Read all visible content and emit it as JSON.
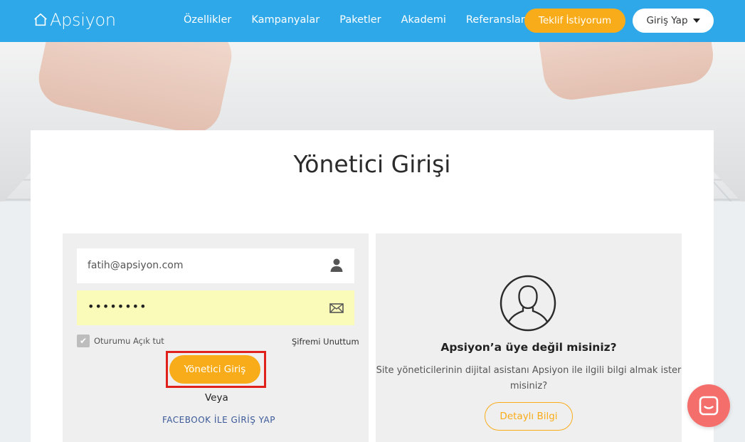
{
  "brand": {
    "name": "Apsiyon"
  },
  "nav": {
    "items": [
      "Özellikler",
      "Kampanyalar",
      "Paketler",
      "Akademi",
      "Referanslar"
    ],
    "offer_button": "Teklif İstiyorum",
    "login_button": "Giriş Yap"
  },
  "page": {
    "title": "Yönetici Girişi"
  },
  "login_form": {
    "email_value": "fatih@apsiyon.com",
    "password_value": "••••••••",
    "remember_label": "Oturumu Açık tut",
    "forgot_link": "Şifremi Unuttum",
    "submit_label": "Yönetici Giriş",
    "or_label": "Veya",
    "facebook_label": "FACEBOOK İLE GİRİŞ YAP"
  },
  "signup_panel": {
    "heading": "Apsiyon’a üye değil misiniz?",
    "description": "Site yöneticilerinin dijital asistanı Apsiyon ile ilgili bilgi almak ister misiniz?",
    "details_button": "Detaylı Bilgi"
  },
  "colors": {
    "nav_bg": "#2ea8e8",
    "accent": "#f9ac19",
    "highlight": "#e0201b",
    "chat_bg": "#f46e6c",
    "autofill_bg": "#fafab9"
  },
  "icons": [
    "home-outline-icon",
    "caret-down-icon",
    "user-icon",
    "envelope-icon",
    "checkmark-icon",
    "user-avatar-icon",
    "chat-icon"
  ]
}
